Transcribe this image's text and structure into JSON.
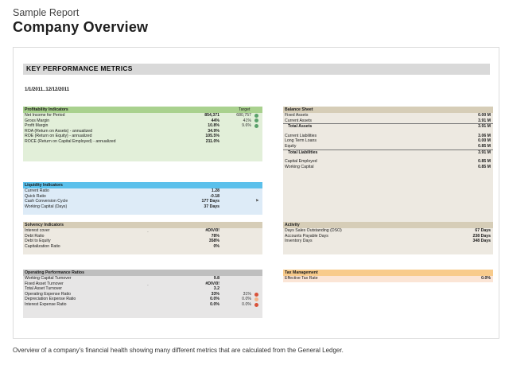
{
  "header": {
    "subtitle": "Sample Report",
    "title": "Company Overview"
  },
  "report": {
    "kpi_title": "KEY PERFORMANCE METRICS",
    "date_range": "1/1/2011..12/12/2011",
    "profitability": {
      "title": "Profitability Indicators",
      "target_label": "Target",
      "rows": [
        {
          "label": "Net Income for Period",
          "value": "854,371",
          "target": "680,757",
          "status": "green"
        },
        {
          "label": "Gross Margin",
          "value": "44%",
          "target": "41%",
          "status": "green"
        },
        {
          "label": "Profit Margin",
          "value": "10.8%",
          "target": "9.6%",
          "status": "green"
        },
        {
          "label": "ROA (Return on Assets) - annualized",
          "value": "34.9%",
          "target": "",
          "status": ""
        },
        {
          "label": "ROE (Return on Equity) - annualized",
          "value": "105.5%",
          "target": "",
          "status": ""
        },
        {
          "label": "ROCE (Return on Capital Employed) - annualized",
          "value": "211.0%",
          "target": "",
          "status": ""
        }
      ]
    },
    "liquidity": {
      "title": "Liquidity Indicators",
      "rows": [
        {
          "label": "Current Ratio",
          "value": "1.28"
        },
        {
          "label": "Quick Ratio",
          "value": "-0.18"
        },
        {
          "label": "Cash Conversion Cycle",
          "value": "177 Days"
        },
        {
          "label": "Working Capital (Days)",
          "value": "37 Days"
        }
      ]
    },
    "solvency": {
      "title": "Solvency Indicators",
      "rows": [
        {
          "label": "Interest cover",
          "value": "#DIV/0!"
        },
        {
          "label": "Debt Ratio",
          "value": "78%"
        },
        {
          "label": "Debt to Equity",
          "value": "358%"
        },
        {
          "label": "Capitalization Ratio",
          "value": "0%"
        }
      ]
    },
    "operating": {
      "title": "Operating Performance Ratios",
      "rows": [
        {
          "label": "Working Capital Turnover",
          "value": "9.8",
          "target": "",
          "status": ""
        },
        {
          "label": "Fixed Asset Turnover",
          "value": "#DIV/0!",
          "target": "",
          "status": ""
        },
        {
          "label": "Total Asset Turnover",
          "value": "3.2",
          "target": "",
          "status": ""
        },
        {
          "label": "Operating Expense Ratio",
          "value": "33%",
          "target": "31%",
          "status": "red"
        },
        {
          "label": "Depreciation Expense Ratio",
          "value": "0.0%",
          "target": "0.0%",
          "status": "peach"
        },
        {
          "label": "Interest Expense Ratio",
          "value": "0.0%",
          "target": "0.0%",
          "status": "red"
        }
      ]
    },
    "balance": {
      "title": "Balance Sheet",
      "fixed_assets_label": "Fixed Assets",
      "fixed_assets": "0.00 M",
      "current_assets_label": "Current Assets",
      "current_assets": "3.91 M",
      "total_assets_label": "Total Assets",
      "total_assets": "3.91 M",
      "current_liabilities_label": "Current Liabilities",
      "current_liabilities": "3.06 M",
      "long_term_loans_label": "Long Term Loans",
      "long_term_loans": "0.00 M",
      "equity_label": "Equity",
      "equity": "0.85 M",
      "total_liabilities_label": "Total Liabilities",
      "total_liabilities": "3.91 M",
      "capital_employed_label": "Capital Employed",
      "capital_employed": "0.85 M",
      "working_capital_label": "Working Capital",
      "working_capital": "0.85 M"
    },
    "activity": {
      "title": "Activity",
      "rows": [
        {
          "label": "Days Sales Outstanding (DSO)",
          "value": "67 Days"
        },
        {
          "label": "Accounts Payable Days",
          "value": "238 Days"
        },
        {
          "label": "Inventory Days",
          "value": "348 Days"
        }
      ]
    },
    "tax": {
      "title": "Tax Management",
      "rate_label": "Effective Tax Rate",
      "rate": "0.0%"
    }
  },
  "colors": {
    "green": "#5aa16b",
    "red": "#d9533b",
    "peach": "#f3b48a"
  },
  "caption": "Overview of a company's financial health showing many different metrics that are calculated from the General Ledger."
}
